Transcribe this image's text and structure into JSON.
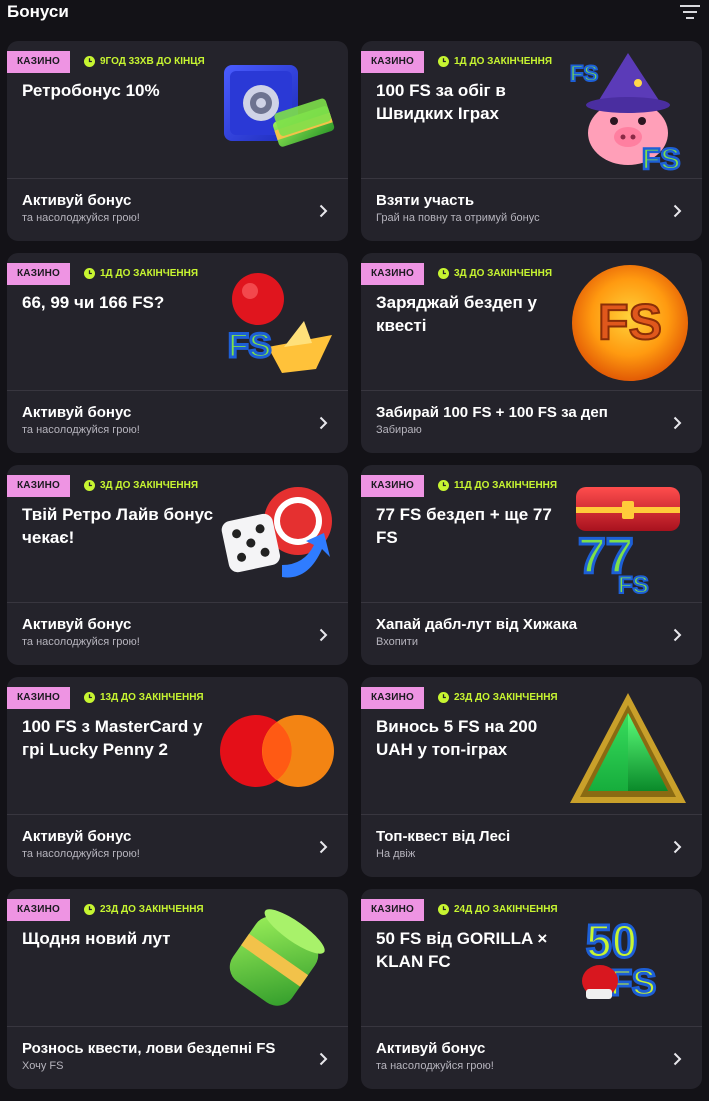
{
  "header": {
    "title": "Бонуси",
    "filter_icon": "filter-lines-icon"
  },
  "cards": [
    {
      "badge": "КАЗИНО",
      "timer": "9ГОД 33ХВ ДО КІНЦЯ",
      "title": "Ретробонус 10%",
      "art": "safe-with-cash",
      "action_title": "Активуй бонус",
      "action_sub": "та насолоджуйся грою!"
    },
    {
      "badge": "КАЗИНО",
      "timer": "1Д ДО ЗАКІНЧЕННЯ",
      "title": "100 FS за обіг в Швидких Іграх",
      "art": "pig-wizard-fs",
      "action_title": "Взяти участь",
      "action_sub": "Грай на повну та отримуй бонус"
    },
    {
      "badge": "КАЗИНО",
      "timer": "1Д ДО ЗАКІНЧЕННЯ",
      "title": "66, 99 чи 166 FS?",
      "art": "balloon-boat-fs",
      "action_title": "Активуй бонус",
      "action_sub": "та насолоджуйся грою!"
    },
    {
      "badge": "КАЗИНО",
      "timer": "3Д ДО ЗАКІНЧЕННЯ",
      "title": "Заряджай бездеп у квесті",
      "art": "sun-fs",
      "action_title": "Забирай 100 FS + 100 FS за деп",
      "action_sub": "Забираю"
    },
    {
      "badge": "КАЗИНО",
      "timer": "3Д ДО ЗАКІНЧЕННЯ",
      "title": "Твій Ретро Лайв бонус чекає!",
      "art": "dice-chip",
      "action_title": "Активуй бонус",
      "action_sub": "та насолоджуйся грою!"
    },
    {
      "badge": "КАЗИНО",
      "timer": "11Д ДО ЗАКІНЧЕННЯ",
      "title": "77 FS бездеп + ще 77 FS",
      "art": "chest-77fs",
      "action_title": "Хапай дабл-лут від Хижака",
      "action_sub": "Вхопити"
    },
    {
      "badge": "КАЗИНО",
      "timer": "13Д ДО ЗАКІНЧЕННЯ",
      "title": "100 FS з MasterCard у грі Lucky Penny 2",
      "art": "mastercard-logo",
      "action_title": "Активуй бонус",
      "action_sub": "та насолоджуйся грою!"
    },
    {
      "badge": "КАЗИНО",
      "timer": "23Д ДО ЗАКІНЧЕННЯ",
      "title": "Винось 5 FS на 200 UAH у топ-іграх",
      "art": "green-gem-triangle",
      "action_title": "Топ-квест від Лесі",
      "action_sub": "На двіж"
    },
    {
      "badge": "КАЗИНО",
      "timer": "23Д ДО ЗАКІНЧЕННЯ",
      "title": "Щодня новий лут",
      "art": "money-roll",
      "action_title": "Рознось квести, лови бездепні FS",
      "action_sub": "Хочу FS"
    },
    {
      "badge": "КАЗИНО",
      "timer": "24Д ДО ЗАКІНЧЕННЯ",
      "title": "50 FS від GORILLA × KLAN FC",
      "art": "boxing-50fs",
      "action_title": "Активуй бонус",
      "action_sub": "та насолоджуйся грою!"
    }
  ],
  "art_text": {
    "fs": "FS",
    "n77": "77",
    "n50": "50"
  }
}
